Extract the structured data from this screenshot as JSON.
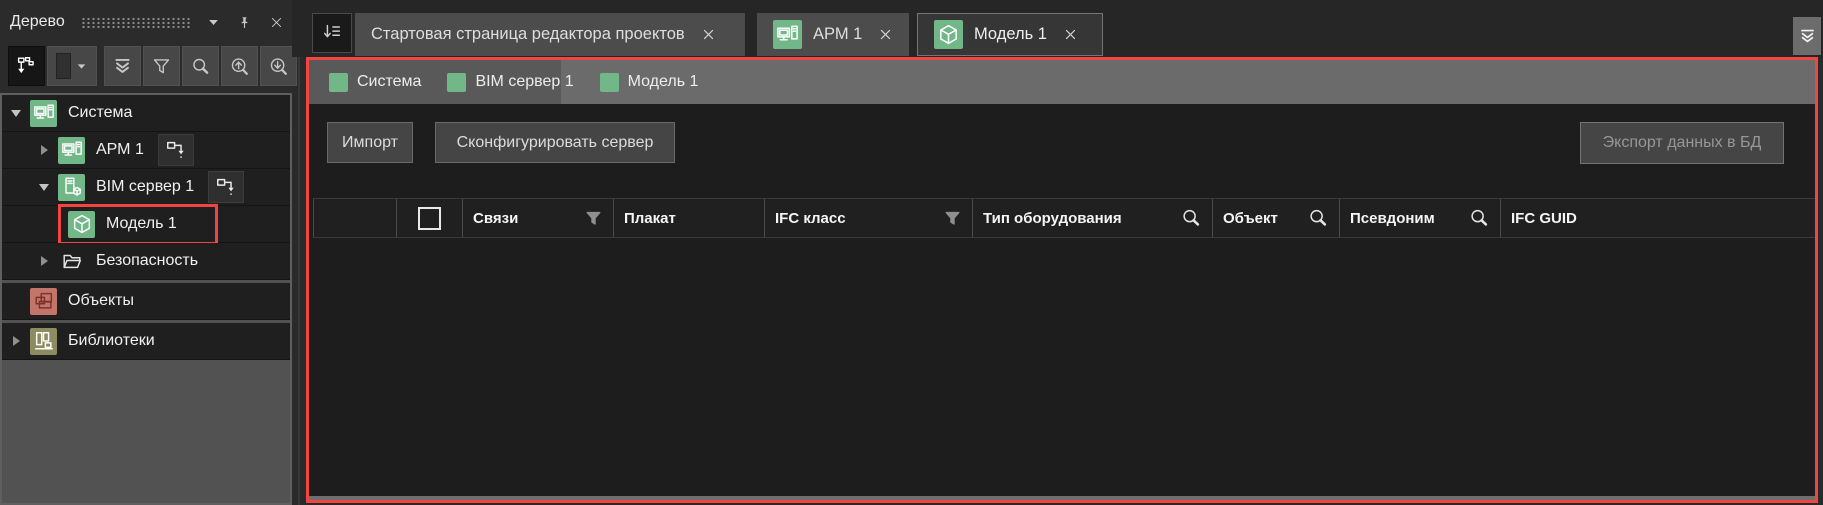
{
  "panel": {
    "title": "Дерево"
  },
  "tree": {
    "items": [
      {
        "label": "Система",
        "state": "expanded"
      },
      {
        "label": "АРМ 1",
        "state": "collapsed"
      },
      {
        "label": "BIM сервер 1",
        "state": "expanded"
      },
      {
        "label": "Модель 1",
        "state": "highlighted"
      },
      {
        "label": "Безопасность",
        "state": "collapsed"
      },
      {
        "label": "Объекты",
        "state": "leaf"
      },
      {
        "label": "Библиотеки",
        "state": "collapsed"
      }
    ]
  },
  "tabs": {
    "items": [
      {
        "label": "Стартовая страница редактора проектов",
        "active": false
      },
      {
        "label": "АРМ 1",
        "active": false
      },
      {
        "label": "Модель 1",
        "active": true
      }
    ]
  },
  "breadcrumbs": {
    "items": [
      {
        "label": "Система"
      },
      {
        "label": "BIM сервер 1"
      },
      {
        "label": "Модель 1"
      }
    ]
  },
  "actions": {
    "import": "Импорт",
    "configure": "Сконфигурировать сервер",
    "export": "Экспорт данных в БД",
    "export_enabled": false
  },
  "table": {
    "columns": [
      {
        "label": "",
        "type": "row-indicator"
      },
      {
        "label": "",
        "type": "checkbox",
        "checked": false
      },
      {
        "label": "Связи",
        "control": "filter"
      },
      {
        "label": "Плакат",
        "control": "none"
      },
      {
        "label": "IFC класс",
        "control": "filter"
      },
      {
        "label": "Тип оборудования",
        "control": "search"
      },
      {
        "label": "Объект",
        "control": "search"
      },
      {
        "label": "Псевдоним",
        "control": "search"
      },
      {
        "label": "IFC GUID",
        "control": "none"
      }
    ],
    "rows": []
  },
  "colors": {
    "accent-red": "#f04541",
    "accent-green": "#72b787",
    "objects-bg": "#c4756a",
    "libraries-bg": "#8c8c60"
  }
}
